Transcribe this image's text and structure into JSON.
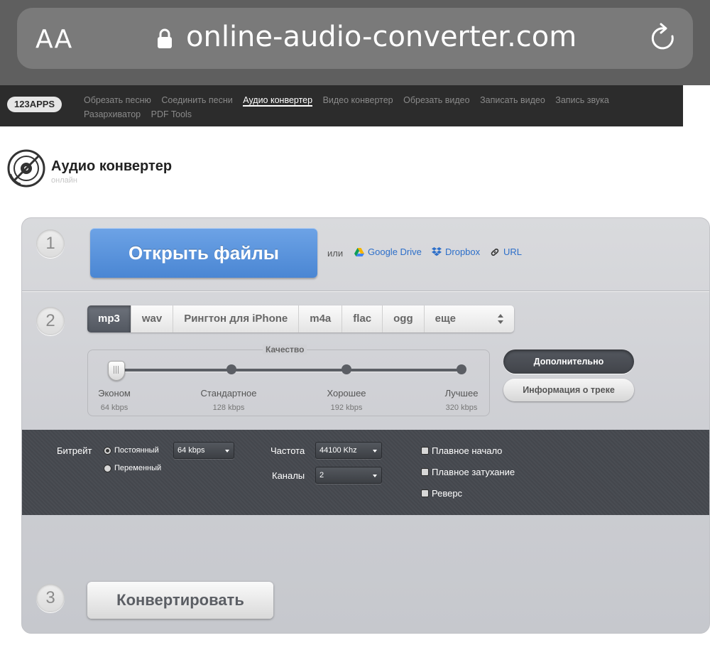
{
  "browser": {
    "aa_label": "AA",
    "url": "online-audio-converter.com",
    "icons": [
      "lock-icon",
      "reload-icon"
    ]
  },
  "site_nav": {
    "brand": "123APPS",
    "links": [
      {
        "label": "Обрезать песню",
        "active": false
      },
      {
        "label": "Соединить песни",
        "active": false
      },
      {
        "label": "Аудио конвертер",
        "active": true
      },
      {
        "label": "Видео конвертер",
        "active": false
      },
      {
        "label": "Обрезать видео",
        "active": false
      },
      {
        "label": "Записать видео",
        "active": false
      },
      {
        "label": "Запись звука",
        "active": false
      },
      {
        "label": "Разархиватор",
        "active": false
      },
      {
        "label": "PDF Tools",
        "active": false
      }
    ]
  },
  "header": {
    "title": "Аудио конвертер",
    "subtitle": "онлайн"
  },
  "steps": [
    "1",
    "2",
    "3"
  ],
  "step1": {
    "open_button": "Открыть файлы",
    "or_text": "или",
    "sources": [
      {
        "label": "Google Drive",
        "icon": "google-drive-icon"
      },
      {
        "label": "Dropbox",
        "icon": "dropbox-icon"
      },
      {
        "label": "URL",
        "icon": "link-icon"
      }
    ]
  },
  "step2": {
    "formats": [
      "mp3",
      "wav",
      "Рингтон для iPhone",
      "m4a",
      "flac",
      "ogg"
    ],
    "selected_format": "mp3",
    "more_label": "еще",
    "quality": {
      "legend": "Качество",
      "levels": [
        {
          "name": "Эконом",
          "rate": "64 kbps"
        },
        {
          "name": "Стандартное",
          "rate": "128 kbps"
        },
        {
          "name": "Хорошее",
          "rate": "192 kbps"
        },
        {
          "name": "Лучшее",
          "rate": "320 kbps"
        }
      ],
      "selected_level_index": 0
    },
    "advanced_button": "Дополнительно",
    "info_button": "Информация о треке"
  },
  "advanced": {
    "bitrate_label": "Битрейт",
    "bitrate_modes": [
      "Постоянный",
      "Переменный"
    ],
    "bitrate_mode_selected": "Постоянный",
    "bitrate_value": "64 kbps",
    "frequency_label": "Частота",
    "frequency_value": "44100 Khz",
    "channels_label": "Каналы",
    "channels_value": "2",
    "effects": [
      {
        "label": "Плавное начало",
        "checked": false
      },
      {
        "label": "Плавное затухание",
        "checked": false
      },
      {
        "label": "Реверс",
        "checked": false
      }
    ]
  },
  "step3": {
    "convert_button": "Конвертировать"
  },
  "colors": {
    "accent_blue": "#4a86d3",
    "nav_bg": "#2c2c2c",
    "advanced_bg": "#46494f"
  }
}
